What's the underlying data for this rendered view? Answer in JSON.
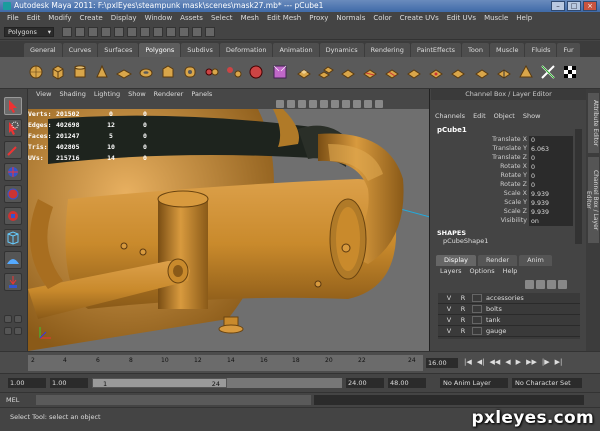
{
  "window": {
    "title": "Autodesk Maya 2011: F:\\pxlEyes\\steampunk mask\\scenes\\mask27.mb*   ---   pCube1"
  },
  "menubar": [
    "File",
    "Edit",
    "Modify",
    "Create",
    "Display",
    "Window",
    "Assets",
    "Select",
    "Mesh",
    "Edit Mesh",
    "Proxy",
    "Normals",
    "Color",
    "Create UVs",
    "Edit UVs",
    "Muscle",
    "Help"
  ],
  "statusline": {
    "mode": "Polygons"
  },
  "shelf_tabs": [
    "General",
    "Curves",
    "Surfaces",
    "Polygons",
    "Subdivs",
    "Deformation",
    "Animation",
    "Dynamics",
    "Rendering",
    "PaintEffects",
    "Toon",
    "Muscle",
    "Fluids",
    "Fur"
  ],
  "shelf_active": "Polygons",
  "viewport": {
    "menu": [
      "View",
      "Shading",
      "Lighting",
      "Show",
      "Renderer",
      "Panels"
    ],
    "hud": [
      {
        "label": "Verts:",
        "v1": "201502",
        "v2": "0",
        "v3": "0"
      },
      {
        "label": "Edges:",
        "v1": "402698",
        "v2": "12",
        "v3": "0"
      },
      {
        "label": "Faces:",
        "v1": "201247",
        "v2": "5",
        "v3": "0"
      },
      {
        "label": "Tris:",
        "v1": "402805",
        "v2": "10",
        "v3": "0"
      },
      {
        "label": "UVs:",
        "v1": "215716",
        "v2": "14",
        "v3": "0"
      }
    ]
  },
  "channel_box": {
    "title": "Channel Box / Layer Editor",
    "menu": [
      "Channels",
      "Edit",
      "Object",
      "Show"
    ],
    "object": "pCube1",
    "attributes": [
      {
        "name": "Translate X",
        "value": "0"
      },
      {
        "name": "Translate Y",
        "value": "6.063"
      },
      {
        "name": "Translate Z",
        "value": "0"
      },
      {
        "name": "Rotate X",
        "value": "0"
      },
      {
        "name": "Rotate Y",
        "value": "0"
      },
      {
        "name": "Rotate Z",
        "value": "0"
      },
      {
        "name": "Scale X",
        "value": "9.939"
      },
      {
        "name": "Scale Y",
        "value": "9.939"
      },
      {
        "name": "Scale Z",
        "value": "9.939"
      },
      {
        "name": "Visibility",
        "value": "on"
      }
    ],
    "shapes_label": "SHAPES",
    "shape_name": "pCubeShape1"
  },
  "layer_editor": {
    "tabs": [
      "Display",
      "Render",
      "Anim"
    ],
    "active_tab": "Display",
    "menu": [
      "Layers",
      "Options",
      "Help"
    ],
    "layers": [
      {
        "v": "V",
        "r": "R",
        "name": "accessories"
      },
      {
        "v": "V",
        "r": "R",
        "name": "bolts"
      },
      {
        "v": "V",
        "r": "R",
        "name": "tank"
      },
      {
        "v": "V",
        "r": "R",
        "name": "gauge"
      }
    ]
  },
  "side_tabs": [
    "Attribute Editor",
    "Channel Box / Layer Editor"
  ],
  "time_slider": {
    "ticks": [
      "2",
      "4",
      "6",
      "8",
      "10",
      "12",
      "14",
      "16",
      "18",
      "20",
      "22",
      "24"
    ],
    "current_frame": "16.00",
    "controls": [
      "|◀",
      "◀|",
      "◀◀",
      "◀",
      "▶",
      "▶▶",
      "|▶",
      "▶|"
    ]
  },
  "range_slider": {
    "start": "1.00",
    "start2": "1.00",
    "range_start": "1",
    "range_end": "24",
    "end": "24.00",
    "end2": "48.00",
    "anim_layer": "No Anim Layer",
    "character_set": "No Character Set"
  },
  "command_line": {
    "language": "MEL"
  },
  "help_line": {
    "text": "Select Tool: select an object"
  },
  "watermark": "pxleyes.com",
  "colors": {
    "model_orange": "#c98a2c",
    "viewport_bg": "#6f6f6f",
    "title_blue": "#3f6aa8"
  }
}
